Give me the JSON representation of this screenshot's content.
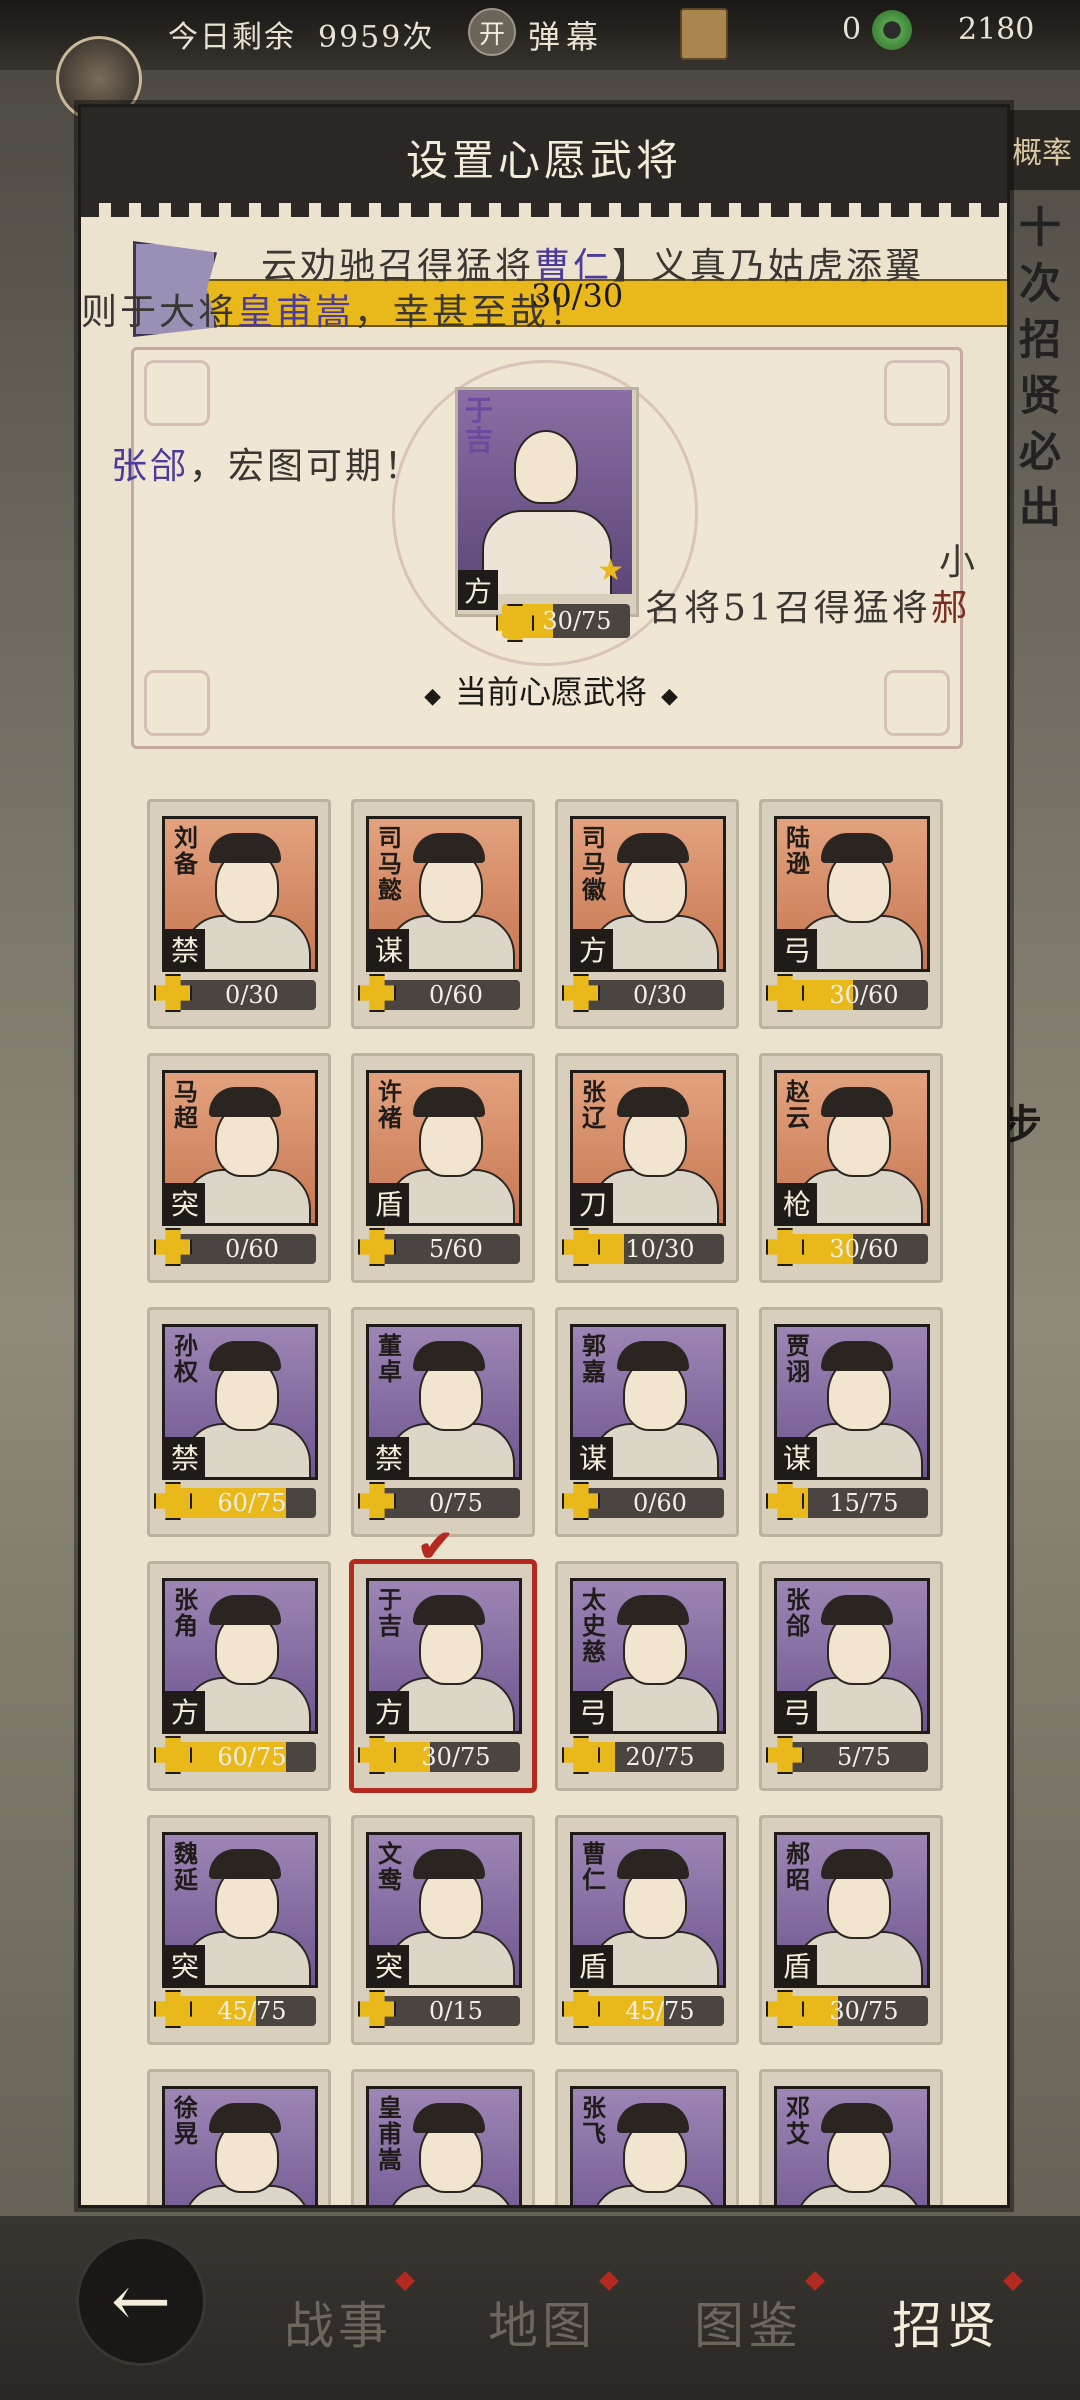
{
  "topbar": {
    "remain_label": "今日剩余",
    "remain_value": "9959次",
    "open_label": "开",
    "danmu_label": "弹幕",
    "count_value": "0",
    "coins_value": "2180"
  },
  "side": {
    "tab_label": "概率",
    "banner_text": "十次招贤必出",
    "step_label": "步"
  },
  "modal": {
    "title": "设置心愿武将",
    "banner_number": "30/30",
    "danmu": [
      {
        "pre": "云劝驰召得猛将",
        "hl": "曹仁",
        "post": "】义真乃姑虎添翼"
      },
      {
        "pre": "则于大将",
        "hl": "皇甫嵩",
        "post": "，幸甚至哉！"
      },
      {
        "pre": "",
        "hl": "张郃",
        "post": "，宏图可期！"
      },
      {
        "pre": "名将51召得猛将",
        "hl": "",
        "post": "郝"
      }
    ],
    "danmu_small": "小",
    "current": {
      "name": "于吉",
      "type": "方",
      "progress": "30/75",
      "fill": 0.4,
      "label": "当前心愿武将"
    }
  },
  "heroes": [
    {
      "name": "刘备",
      "type": "禁",
      "progress": "0/30",
      "fill": 0,
      "bg": "orange",
      "selected": false
    },
    {
      "name": "司马懿",
      "type": "谋",
      "progress": "0/60",
      "fill": 0,
      "bg": "orange",
      "selected": false
    },
    {
      "name": "司马徽",
      "type": "方",
      "progress": "0/30",
      "fill": 0,
      "bg": "orange",
      "selected": false
    },
    {
      "name": "陆逊",
      "type": "弓",
      "progress": "30/60",
      "fill": 0.5,
      "bg": "orange",
      "selected": false
    },
    {
      "name": "马超",
      "type": "突",
      "progress": "0/60",
      "fill": 0,
      "bg": "orange",
      "selected": false
    },
    {
      "name": "许褚",
      "type": "盾",
      "progress": "5/60",
      "fill": 0.08,
      "bg": "orange",
      "selected": false
    },
    {
      "name": "张辽",
      "type": "刀",
      "progress": "10/30",
      "fill": 0.33,
      "bg": "orange",
      "selected": false
    },
    {
      "name": "赵云",
      "type": "枪",
      "progress": "30/60",
      "fill": 0.5,
      "bg": "orange",
      "selected": false
    },
    {
      "name": "孙权",
      "type": "禁",
      "progress": "60/75",
      "fill": 0.8,
      "bg": "purple",
      "selected": false
    },
    {
      "name": "董卓",
      "type": "禁",
      "progress": "0/75",
      "fill": 0,
      "bg": "purple",
      "selected": false
    },
    {
      "name": "郭嘉",
      "type": "谋",
      "progress": "0/60",
      "fill": 0,
      "bg": "purple",
      "selected": false
    },
    {
      "name": "贾诩",
      "type": "谋",
      "progress": "15/75",
      "fill": 0.2,
      "bg": "purple",
      "selected": false
    },
    {
      "name": "张角",
      "type": "方",
      "progress": "60/75",
      "fill": 0.8,
      "bg": "purple",
      "selected": false
    },
    {
      "name": "于吉",
      "type": "方",
      "progress": "30/75",
      "fill": 0.4,
      "bg": "purple",
      "selected": true
    },
    {
      "name": "太史慈",
      "type": "弓",
      "progress": "20/75",
      "fill": 0.27,
      "bg": "purple",
      "selected": false
    },
    {
      "name": "张郃",
      "type": "弓",
      "progress": "5/75",
      "fill": 0.07,
      "bg": "purple",
      "selected": false
    },
    {
      "name": "魏延",
      "type": "突",
      "progress": "45/75",
      "fill": 0.6,
      "bg": "purple",
      "selected": false
    },
    {
      "name": "文鸯",
      "type": "突",
      "progress": "0/15",
      "fill": 0,
      "bg": "purple",
      "selected": false
    },
    {
      "name": "曹仁",
      "type": "盾",
      "progress": "45/75",
      "fill": 0.6,
      "bg": "purple",
      "selected": false
    },
    {
      "name": "郝昭",
      "type": "盾",
      "progress": "30/75",
      "fill": 0.4,
      "bg": "purple",
      "selected": false
    },
    {
      "name": "徐晃",
      "type": "",
      "progress": "",
      "fill": 0,
      "bg": "purple",
      "selected": false
    },
    {
      "name": "皇甫嵩",
      "type": "",
      "progress": "",
      "fill": 0,
      "bg": "purple",
      "selected": false
    },
    {
      "name": "张飞",
      "type": "",
      "progress": "",
      "fill": 0,
      "bg": "purple",
      "selected": false
    },
    {
      "name": "邓艾",
      "type": "",
      "progress": "",
      "fill": 0,
      "bg": "purple",
      "selected": false
    }
  ],
  "nav": {
    "items": [
      "战事",
      "地图",
      "图鉴",
      "招贤"
    ],
    "active_index": 3
  },
  "colors": {
    "accent": "#e9b81b",
    "selected": "#b52a20",
    "dark": "#1e1b18"
  }
}
